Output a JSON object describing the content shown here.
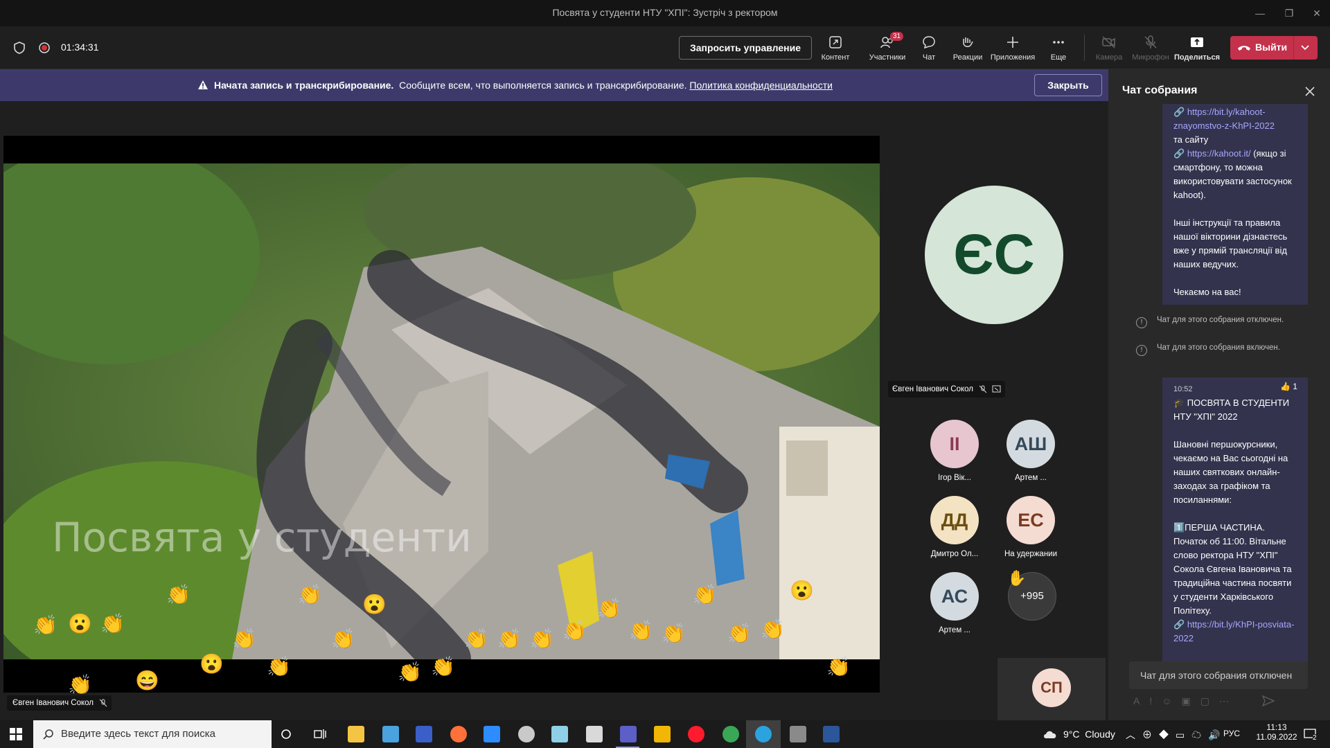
{
  "window": {
    "title": "Посвята у студенти НТУ \"ХПІ\": Зустріч з ректором"
  },
  "toolbar": {
    "timer": "01:34:31",
    "request_control": "Запросить управление",
    "content": "Контент",
    "participants": "Участники",
    "participants_badge": "31",
    "chat": "Чат",
    "reactions": "Реакции",
    "apps": "Приложения",
    "more": "Еще",
    "camera": "Камера",
    "mic": "Микрофон",
    "share": "Поделиться",
    "leave": "Выйти"
  },
  "banner": {
    "bold": "Начата запись и транскрибирование.",
    "text": "Сообщите всем, что выполняется запись и транскрибирование.",
    "link": "Политика конфиденциальности",
    "close": "Закрыть"
  },
  "stage": {
    "speaker_label": "Євген Іванович Сокол",
    "video_caption": "Посвята у студенти"
  },
  "participants": {
    "main_initials": "ЄС",
    "main_name": "Євген Іванович Сокол",
    "tiles": [
      {
        "initials": "ІІ",
        "name": "Ігор Вік...",
        "color": "#e7c6cf",
        "text_color": "#8b3a55"
      },
      {
        "initials": "АШ",
        "name": "Артем ...",
        "color": "#d4dbe0",
        "text_color": "#34495a"
      },
      {
        "initials": "ДД",
        "name": "Дмитро Ол...",
        "color": "#f3e3c3",
        "text_color": "#6b4e10"
      },
      {
        "initials": "ЕС",
        "name": "На удержании",
        "color": "#f5dcd3",
        "text_color": "#7a3b23"
      },
      {
        "initials": "АС",
        "name": "Артем ...",
        "color": "#d4dbe0",
        "text_color": "#34495a"
      }
    ],
    "more_count": "+995",
    "self_initials": "СП"
  },
  "chat": {
    "title": "Чат собрания",
    "msg1": {
      "link1a": "https://bit.ly/kahoot-",
      "link1b": "znayomstvo-z-KhPI-2022",
      "t1": "та сайту",
      "link2": "https://kahoot.it/",
      "t2": "(якщо зі смартфону, то можна використовувати застосунок kahoot).",
      "t3": "Інші інструкції та правила нашої вікторини дізнаєтесь вже у прямій трансляції від наших ведучих.",
      "t4": "Чекаємо на вас!"
    },
    "sys1": "Чат для этого собрания отключен.",
    "sys2": "Чат для этого собрания включен.",
    "msg2": {
      "time": "10:52",
      "reaction_count": "1",
      "head": "🎓 ПОСВЯТА В СТУДЕНТИ НТУ \"ХПІ\" 2022",
      "p1": "Шановні першокурсники, чекаємо на Вас сьогодні на наших святкових онлайн-заходах за графіком та посиланнями:",
      "p2": "1️⃣ПЕРША ЧАСТИНА. Початок об 11:00. Вітальне слово ректора НТУ \"ХПІ\" Сокола Євгена Івановича та традиційна частина посвяти у студенти Харківського Політеху.",
      "link": "https://bit.ly/KhPI-posviata-2022"
    },
    "input_placeholder": "Чат для этого собрания отключен"
  },
  "taskbar": {
    "search_placeholder": "Введите здесь текст для поиска",
    "weather": "9°C  Cloudy",
    "lang": "РУС",
    "time": "11:13",
    "date": "11.09.2022",
    "notif_count": "2"
  },
  "colors": {
    "accent": "#6264a7",
    "leave": "#c4314b",
    "banner": "#3d3a6b"
  }
}
